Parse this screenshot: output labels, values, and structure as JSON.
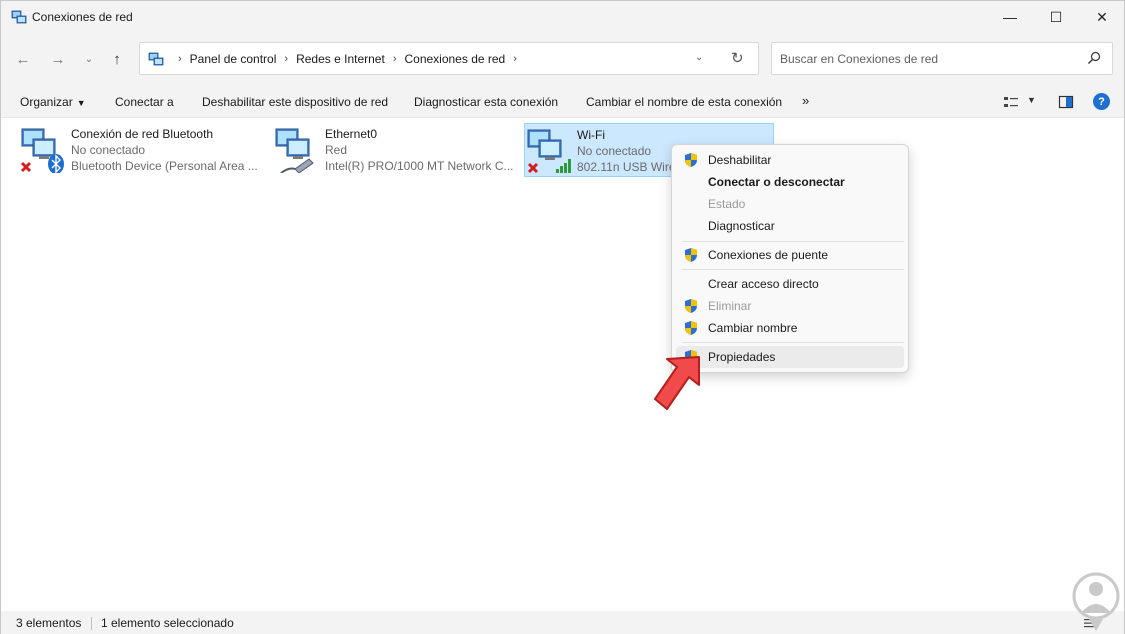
{
  "window": {
    "title": "Conexiones de red",
    "controls": {
      "minimize": "—",
      "maximize": "☐",
      "close": "✕"
    }
  },
  "nav": {
    "back": "←",
    "forward": "→",
    "recent": "⌄",
    "up": "↑",
    "breadcrumbs": [
      "Panel de control",
      "Redes e Internet",
      "Conexiones de red"
    ],
    "refresh": "↻",
    "dropdown": "⌄"
  },
  "search": {
    "placeholder": "Buscar en Conexiones de red"
  },
  "commands": {
    "organize": "Organizar",
    "connect": "Conectar a",
    "disable_device": "Deshabilitar este dispositivo de red",
    "diagnose": "Diagnosticar esta conexión",
    "rename": "Cambiar el nombre de esta conexión",
    "more": "»",
    "help": "?"
  },
  "connections": [
    {
      "name": "Conexión de red Bluetooth",
      "status": "No conectado",
      "device": "Bluetooth Device (Personal Area ...",
      "icon": "bluetooth-network-icon",
      "selected": false
    },
    {
      "name": "Ethernet0",
      "status": "Red",
      "device": "Intel(R) PRO/1000 MT Network C...",
      "icon": "ethernet-network-icon",
      "selected": false
    },
    {
      "name": "Wi-Fi",
      "status": "No conectado",
      "device": "802.11n USB Wire",
      "icon": "wifi-network-icon",
      "selected": true
    }
  ],
  "context_menu": {
    "items": [
      {
        "label": "Deshabilitar",
        "shield": true,
        "bold": false,
        "disabled": false
      },
      {
        "label": "Conectar o desconectar",
        "shield": false,
        "bold": true,
        "disabled": false
      },
      {
        "label": "Estado",
        "shield": false,
        "bold": false,
        "disabled": true
      },
      {
        "label": "Diagnosticar",
        "shield": false,
        "bold": false,
        "disabled": false
      },
      {
        "label": "Conexiones de puente",
        "shield": true,
        "bold": false,
        "disabled": false
      },
      {
        "label": "Crear acceso directo",
        "shield": false,
        "bold": false,
        "disabled": false
      },
      {
        "label": "Eliminar",
        "shield": true,
        "bold": false,
        "disabled": true
      },
      {
        "label": "Cambiar nombre",
        "shield": true,
        "bold": false,
        "disabled": false
      },
      {
        "label": "Propiedades",
        "shield": true,
        "bold": false,
        "disabled": false,
        "hovered": true
      }
    ]
  },
  "status": {
    "count": "3 elementos",
    "selection": "1 elemento seleccionado"
  },
  "colors": {
    "accent": "#1f6fd1",
    "selection_bg": "#cce8ff",
    "arrow": "#f04a4a"
  }
}
